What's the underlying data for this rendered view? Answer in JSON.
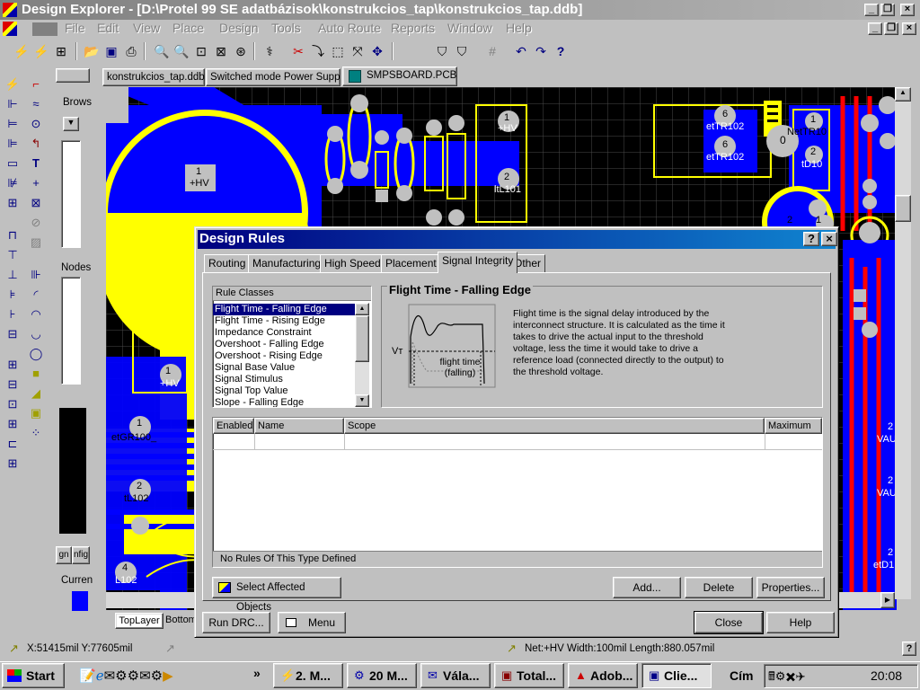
{
  "app": {
    "title": "Design Explorer - [D:\\Protel 99 SE adatbázisok\\konstrukcios_tap\\konstrukcios_tap.ddb]"
  },
  "menu": [
    "File",
    "Edit",
    "View",
    "Place",
    "Design",
    "Tools",
    "Auto Route",
    "Reports",
    "Window",
    "Help"
  ],
  "doc_tabs": [
    {
      "label": "konstrukcios_tap.ddb"
    },
    {
      "label": "Switched mode Power Supply"
    },
    {
      "label": "SMPSBOARD.PCB",
      "active": true
    }
  ],
  "browse": {
    "title": "Brows",
    "nodes": "Nodes",
    "current": "Curren",
    "mini_tabs": [
      "gn",
      "nfig"
    ]
  },
  "pcb": {
    "labels": [
      {
        "text": "1"
      },
      {
        "text": "+HV"
      },
      {
        "text": "1"
      },
      {
        "text": "+HV"
      },
      {
        "text": "1"
      },
      {
        "text": "+HV"
      },
      {
        "text": "1"
      },
      {
        "text": "etGR100_"
      },
      {
        "text": "2"
      },
      {
        "text": "tL102"
      },
      {
        "text": "4"
      },
      {
        "text": "L102"
      },
      {
        "text": "2"
      },
      {
        "text": "ltL101"
      },
      {
        "text": "6"
      },
      {
        "text": "etTR102"
      },
      {
        "text": "6"
      },
      {
        "text": "etTR102"
      },
      {
        "text": "0"
      },
      {
        "text": "1"
      },
      {
        "text": "NetTR10"
      },
      {
        "text": "2"
      },
      {
        "text": "tD10"
      },
      {
        "text": "2"
      },
      {
        "text": "1"
      },
      {
        "text": "2"
      },
      {
        "text": "VAU"
      },
      {
        "text": "2"
      },
      {
        "text": "VAU"
      },
      {
        "text": "2"
      },
      {
        "text": "etD1"
      }
    ],
    "layer_tabs": [
      "TopLayer",
      "Bottom"
    ],
    "colors": {
      "bg": "#000000",
      "copper_top": "#0000ff",
      "copper_bottom": "#ff0000",
      "silk": "#ffff00",
      "pad": "#c0c0c0",
      "grid": "#555555"
    }
  },
  "dialog": {
    "title": "Design Rules",
    "tabs": [
      "Routing",
      "Manufacturing",
      "High Speed",
      "Placement",
      "Signal Integrity",
      "Other"
    ],
    "active_tab": "Signal Integrity",
    "rule_classes_label": "Rule Classes",
    "rule_classes": [
      "Flight Time - Falling Edge",
      "Flight Time - Rising Edge",
      "Impedance Constraint",
      "Overshoot - Falling Edge",
      "Overshoot - Rising Edge",
      "Signal Base Value",
      "Signal Stimulus",
      "Signal Top Value",
      "Slope - Falling Edge"
    ],
    "selected_rule": "Flight Time - Falling Edge",
    "group_title": "Flight Time - Falling Edge",
    "diagram": {
      "vt": "Vт",
      "caption1": "flight time",
      "caption2": "(falling)"
    },
    "description": "Flight time is the signal delay introduced by the interconnect structure.  It is calculated as the time it takes to drive the actual input to the threshold voltage, less the time it would take to drive a reference load (connected directly to the output) to the threshold voltage.",
    "table": {
      "headers": [
        "Enabled",
        "Name",
        "Scope",
        "Maximum"
      ],
      "status": "No Rules Of This Type Defined"
    },
    "buttons": {
      "select_affected": "Select Affected Objects",
      "add": "Add...",
      "delete": "Delete",
      "properties": "Properties...",
      "run_drc": "Run DRC...",
      "menu": "Menu",
      "close": "Close",
      "help": "Help"
    }
  },
  "status": {
    "coords": "X:51415mil Y:77605mil",
    "net": "Net:+HV Width:100mil Length:880.057mil"
  },
  "taskbar": {
    "start": "Start",
    "tasks": [
      "2. M...",
      "20 M...",
      "Vála...",
      "Total...",
      "Adob...",
      "Clie..."
    ],
    "address": "Cím",
    "clock": "20:08"
  }
}
